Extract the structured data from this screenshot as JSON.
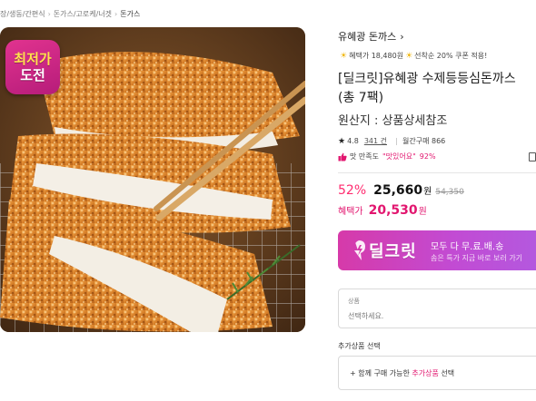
{
  "breadcrumb": [
    "장/생동/간편식",
    "돈가스/고로케/너겟",
    "돈가스"
  ],
  "badge": {
    "line1": "최저가",
    "line2": "도전"
  },
  "brand": {
    "name": "유혜광 돈까스",
    "chevron": "›"
  },
  "promo": {
    "text_before": "혜택가 18,480원",
    "text_after": "선착순 20% 쿠폰 적용!"
  },
  "product": {
    "title_line1": "[딜크릿]유혜광 수제등등심돈까스",
    "title_line2": "(총 7팩)",
    "origin": "원산지 : 상품상세참조"
  },
  "stats": {
    "rating": "4.8",
    "reviews": "341 건",
    "monthly": "월간구매 866"
  },
  "satisfaction": {
    "label": "맛 만족도",
    "quote": "\"맛있어요\"",
    "percent": "92%"
  },
  "price": {
    "discount": "52%",
    "sale": "25,660",
    "won": "원",
    "original": "54,350",
    "benefit_label": "혜택가",
    "benefit_price": "20,530",
    "benefit_won": "원"
  },
  "banner": {
    "logo": "딜크릿",
    "line1": "모두 다 무.료.배.송",
    "line2": "솜은 특가 지금 바로 보러 가기"
  },
  "option": {
    "label": "상품",
    "placeholder": "선택하세요."
  },
  "addon": {
    "title": "추가상품 선택",
    "prefix": "+ 함께 구매 가능한 ",
    "highlight": "추가상품",
    "suffix": " 선택"
  },
  "colors": {
    "accent": "#e2166f",
    "discount": "#ff2b6f",
    "banner_start": "#d63aa9",
    "banner_end": "#b25ae0"
  },
  "icons": [
    "star-icon",
    "thumb-up-icon",
    "sun-icon",
    "bolt-icon",
    "share-icon",
    "chevron-right-icon"
  ]
}
